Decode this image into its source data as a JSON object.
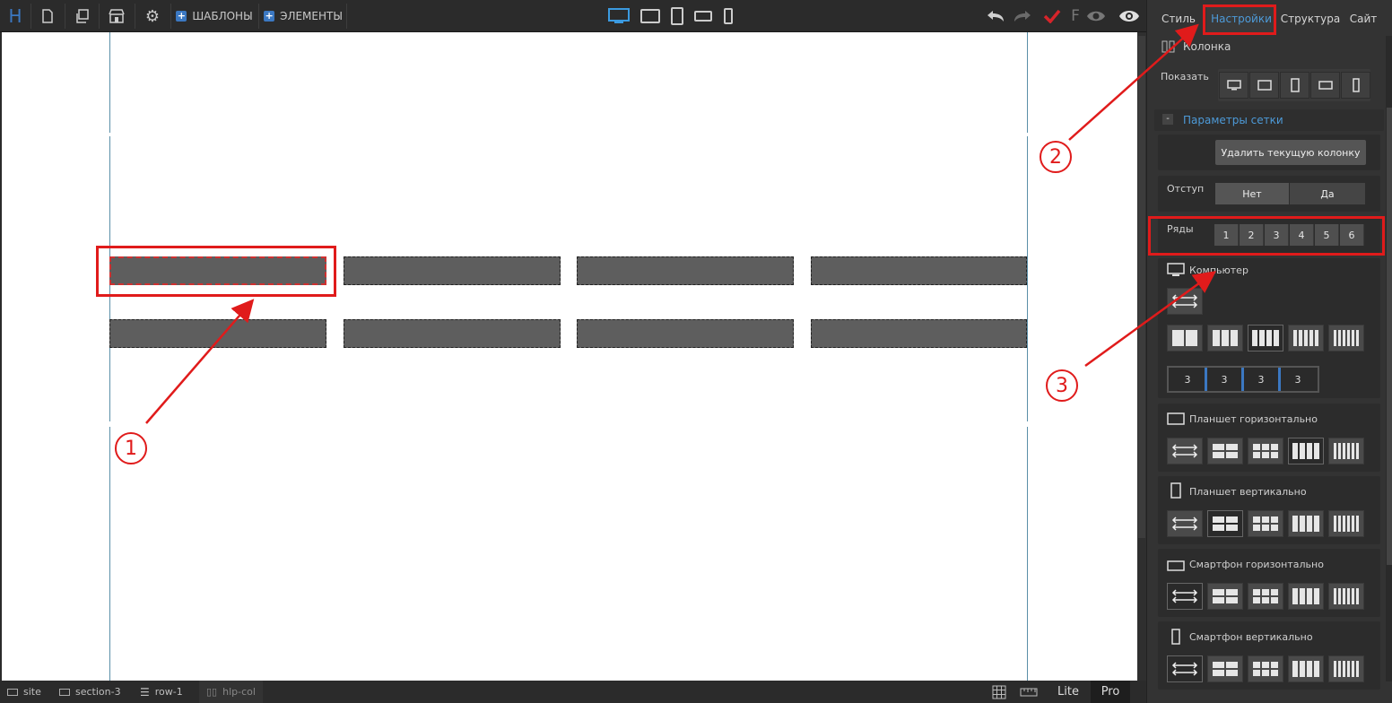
{
  "toolbar": {
    "logo": "H",
    "templates_label": "ШАБЛОНЫ",
    "elements_label": "ЭЛЕМЕНТЫ",
    "f_label": "F"
  },
  "panel": {
    "tabs": [
      {
        "label": "Стиль",
        "active": false
      },
      {
        "label": "Настройки",
        "active": true
      },
      {
        "label": "Структура",
        "active": false
      },
      {
        "label": "Сайт",
        "active": false
      }
    ],
    "element_title": "Колонка",
    "show_label": "Показать",
    "grid_section": "Параметры сетки",
    "collapse_symbol": "-",
    "delete_column": "Удалить текущую колонку",
    "indent_label": "Отступ",
    "indent_no": "Нет",
    "indent_yes": "Да",
    "rows_label": "Ряды",
    "rows": [
      "1",
      "2",
      "3",
      "4",
      "5",
      "6"
    ],
    "devices": {
      "computer": "Компьютер",
      "tablet_h": "Планшет горизонтально",
      "tablet_v": "Планшет вертикально",
      "phone_h": "Смартфон горизонтально",
      "phone_v": "Смартфон вертикально"
    },
    "column_split": [
      "3",
      "3",
      "3",
      "3"
    ],
    "accent_color": "#4d9ad8"
  },
  "annotations": {
    "one": "1",
    "two": "2",
    "three": "3",
    "color": "#e01b1b"
  },
  "statusbar": {
    "crumbs": [
      "site",
      "section-3",
      "row-1",
      "hlp-col"
    ],
    "lite": "Lite",
    "pro": "Pro"
  }
}
